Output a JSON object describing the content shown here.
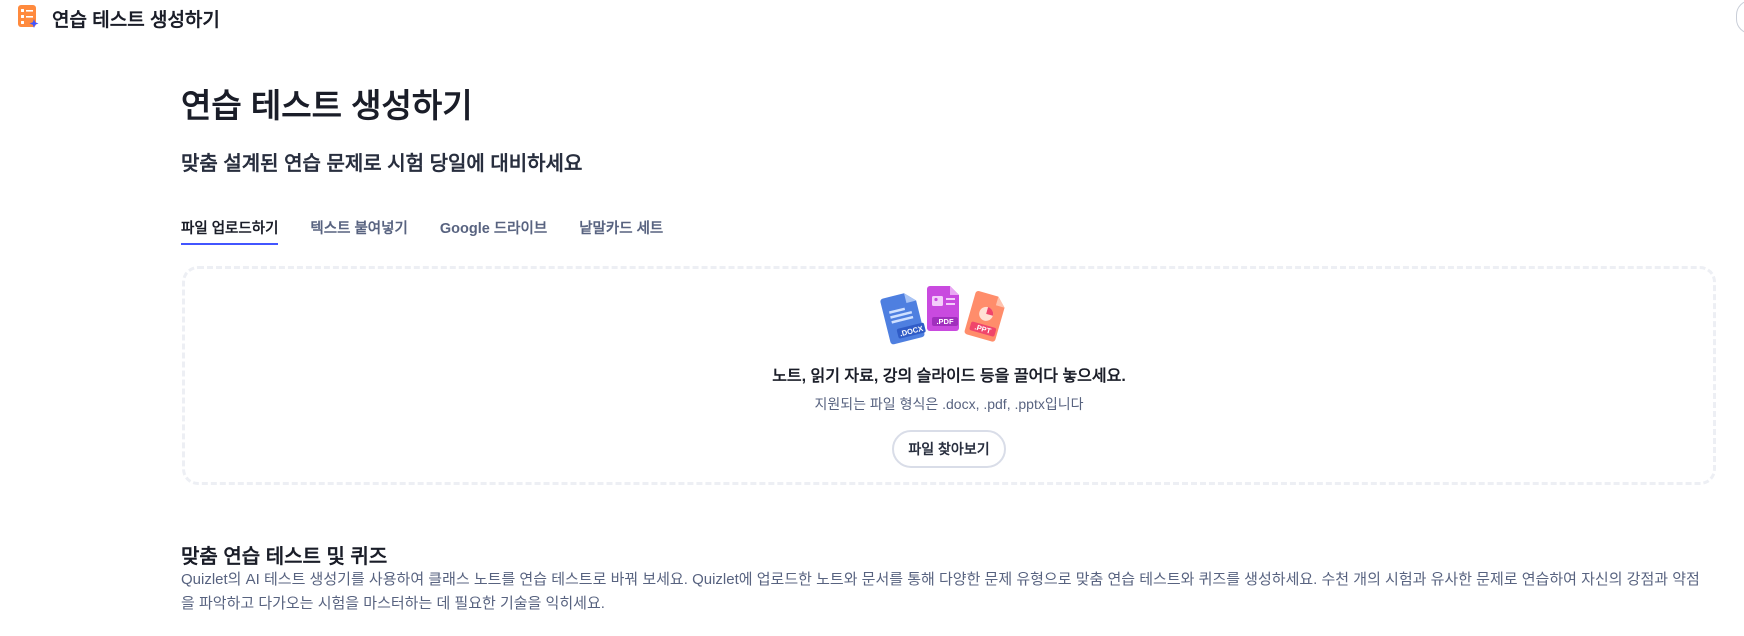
{
  "header": {
    "app_title": "연습 테스트 생성하기",
    "icon": "checklist-sparkle-icon",
    "icon_color": "#ff8a3d",
    "accent_color": "#4255ff"
  },
  "main": {
    "title": "연습 테스트 생성하기",
    "subtitle": "맞춤 설계된 연습 문제로 시험 당일에 대비하세요",
    "tabs": [
      {
        "label": "파일 업로드하기",
        "active": true
      },
      {
        "label": "텍스트 붙여넣기",
        "active": false
      },
      {
        "label": "Google 드라이브",
        "active": false
      },
      {
        "label": "낱말카드 세트",
        "active": false
      }
    ]
  },
  "upload": {
    "file_icons": [
      {
        "icon": "docx-file-icon",
        "label": ".DOCX",
        "color": "#4e7fe0"
      },
      {
        "icon": "pdf-file-icon",
        "label": ".PDF",
        "color": "#c94adf"
      },
      {
        "icon": "ppt-file-icon",
        "label": ".PPT",
        "color": "#f0456b"
      }
    ],
    "prompt": "노트, 읽기 자료, 강의 슬라이드 등을 끌어다 놓으세요.",
    "formats": "지원되는 파일 형식은 .docx, .pdf, .pptx입니다",
    "browse_label": "파일 찾아보기"
  },
  "section": {
    "title": "맞춤 연습 테스트 및 퀴즈",
    "body": "Quizlet의 AI 테스트 생성기를 사용하여 클래스 노트를 연습 테스트로 바꿔 보세요. Quizlet에 업로드한 노트와 문서를 통해 다양한 문제 유형으로 맞춤 연습 테스트와 퀴즈를 생성하세요. 수천 개의 시험과 유사한 문제로 연습하여 자신의 강점과 약점을 파악하고 다가오는 시험을 마스터하는 데 필요한 기술을 익히세요."
  }
}
